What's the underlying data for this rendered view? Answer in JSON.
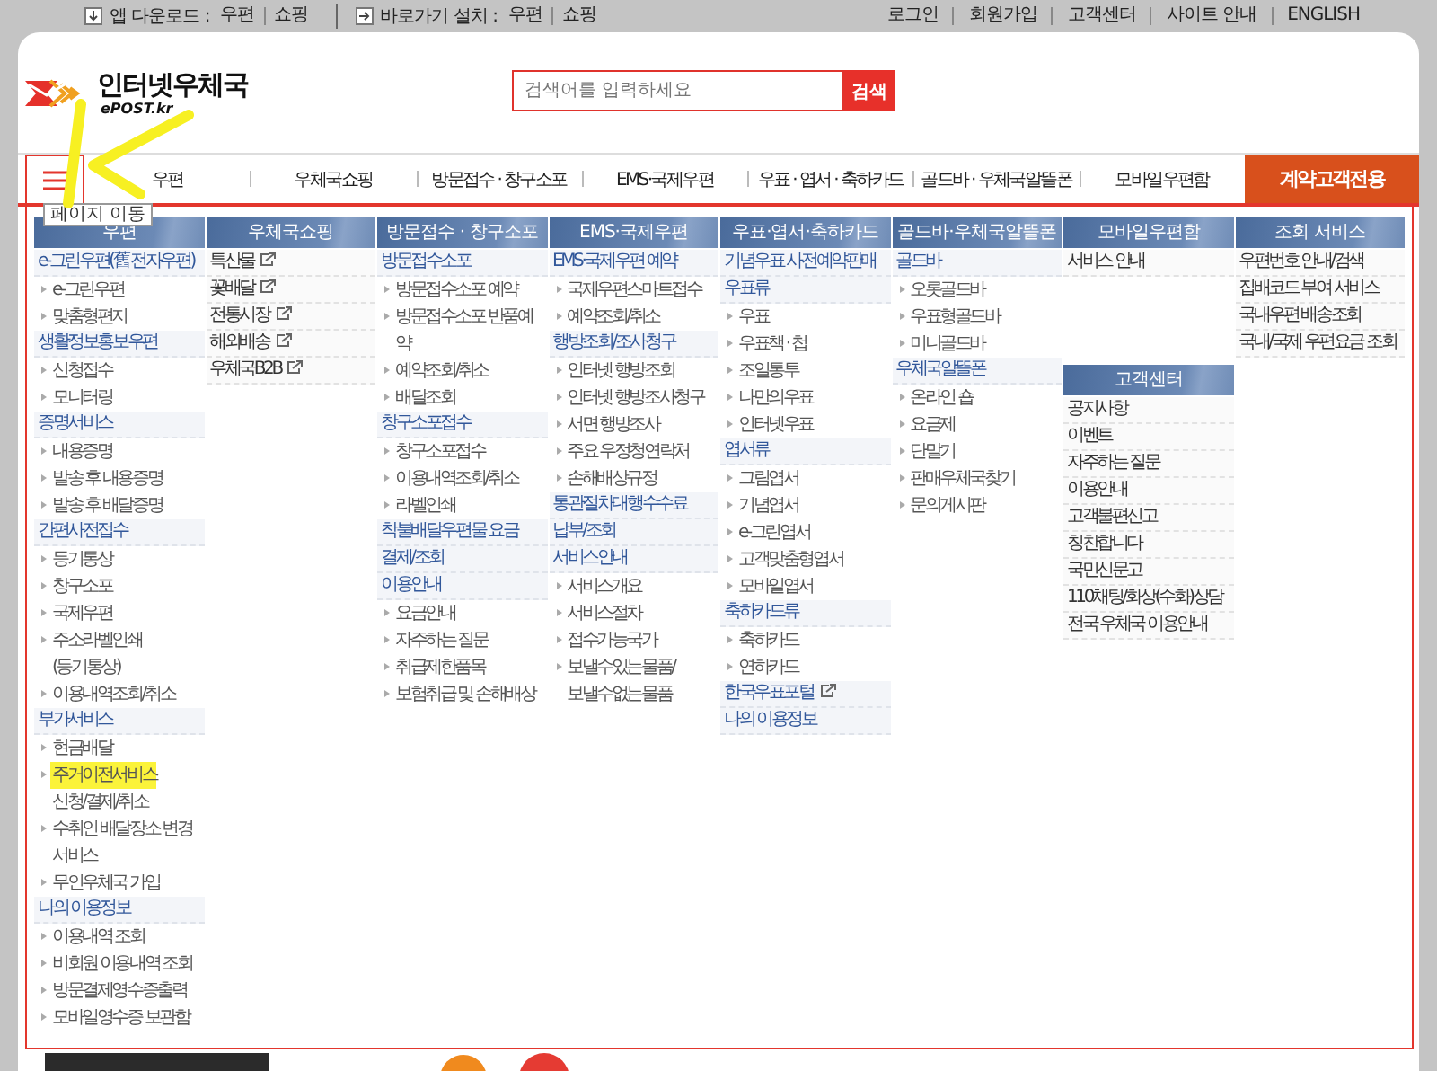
{
  "top_bar": {
    "groups": [
      {
        "kind": "download",
        "label": "앱 다운로드 :",
        "links": [
          "우편",
          "쇼핑"
        ]
      },
      {
        "kind": "shortcut",
        "label": "바로가기 설치 :",
        "links": [
          "우편",
          "쇼핑"
        ]
      }
    ],
    "user_links": [
      "로그인",
      "회원가입",
      "고객센터",
      "사이트 안내",
      "ENGLISH"
    ]
  },
  "header": {
    "logo": {
      "title": "인터넷우체국",
      "subtitle": "ePOST.kr"
    },
    "search": {
      "placeholder": "검색어를 입력하세요",
      "button": "검색"
    }
  },
  "nav": {
    "tooltip": "페이지 이동",
    "items": [
      {
        "label": "우편",
        "kind": "normal"
      },
      {
        "label": "우체국쇼핑",
        "kind": "normal"
      },
      {
        "label": "방문접수 · 창구소포",
        "kind": "normal"
      },
      {
        "label": "EMS·국제우편",
        "kind": "normal"
      },
      {
        "label": "우표 · 엽서 · 축하카드",
        "kind": "normal"
      },
      {
        "label": "골드바 · 우체국알뜰폰",
        "kind": "normal"
      },
      {
        "label": "모바일우편함",
        "kind": "normal"
      },
      {
        "label": "계약고객전용",
        "kind": "special"
      }
    ]
  },
  "mega_menu": {
    "columns": [
      {
        "panels": [
          {
            "title": "우편",
            "items": [
              {
                "text": "e-그린우편(舊 전자우편)",
                "kind": "section",
                "highlighted": false
              },
              {
                "text": "e-그린우편",
                "kind": "sub",
                "highlighted": false
              },
              {
                "text": "맞춤형편지",
                "kind": "sub",
                "highlighted": false
              },
              {
                "text": "생활정보홍보우편",
                "kind": "section",
                "highlighted": false
              },
              {
                "text": "신청접수",
                "kind": "sub",
                "highlighted": false
              },
              {
                "text": "모니터링",
                "kind": "sub",
                "highlighted": false
              },
              {
                "text": "증명서비스",
                "kind": "section",
                "highlighted": false
              },
              {
                "text": "내용증명",
                "kind": "sub",
                "highlighted": false
              },
              {
                "text": "발송 후 내용증명",
                "kind": "sub",
                "highlighted": false
              },
              {
                "text": "발송 후 배달증명",
                "kind": "sub",
                "highlighted": false
              },
              {
                "text": "간편사전접수",
                "kind": "section",
                "highlighted": false
              },
              {
                "text": "등기통상",
                "kind": "sub",
                "highlighted": false
              },
              {
                "text": "창구소포",
                "kind": "sub",
                "highlighted": false
              },
              {
                "text": "국제우편",
                "kind": "sub",
                "highlighted": false
              },
              {
                "text": "주소라벨인쇄",
                "kind": "sub",
                "highlighted": false
              },
              {
                "text": "(등기통상)",
                "kind": "cont",
                "highlighted": false
              },
              {
                "text": "이용내역조회/취소",
                "kind": "sub",
                "highlighted": false
              },
              {
                "text": "부가서비스",
                "kind": "section",
                "highlighted": false
              },
              {
                "text": "현금배달",
                "kind": "sub",
                "highlighted": false
              },
              {
                "text": "주거이전서비스",
                "kind": "sub",
                "highlighted": true
              },
              {
                "text": "신청/결제/취소",
                "kind": "cont",
                "highlighted": false
              },
              {
                "text": "수취인 배달장소 변경",
                "kind": "sub",
                "highlighted": false
              },
              {
                "text": "서비스",
                "kind": "cont",
                "highlighted": false
              },
              {
                "text": "무인우체국 가입",
                "kind": "sub",
                "highlighted": false
              },
              {
                "text": "나의 이용정보",
                "kind": "section",
                "highlighted": false
              },
              {
                "text": "이용내역 조회",
                "kind": "sub",
                "highlighted": false
              },
              {
                "text": "비회원 이용내역 조회",
                "kind": "sub",
                "highlighted": false
              },
              {
                "text": "방문결제영수증출력",
                "kind": "sub",
                "highlighted": false
              },
              {
                "text": "모바일영수증 보관함",
                "kind": "sub",
                "highlighted": false
              }
            ]
          }
        ]
      },
      {
        "panels": [
          {
            "title": "우체국쇼핑",
            "items": [
              {
                "text": "특산물",
                "kind": "plain",
                "external": true
              },
              {
                "text": "꽃배달",
                "kind": "plain",
                "external": true
              },
              {
                "text": "전통시장",
                "kind": "plain",
                "external": true
              },
              {
                "text": "해외배송",
                "kind": "plain",
                "external": true
              },
              {
                "text": "우체국B2B",
                "kind": "plain",
                "external": true
              }
            ]
          }
        ]
      },
      {
        "panels": [
          {
            "title": "방문접수 · 창구소포",
            "items": [
              {
                "text": "방문접수소포",
                "kind": "section"
              },
              {
                "text": "방문접수소포 예약",
                "kind": "sub"
              },
              {
                "text": "방문접수소포 반품예",
                "kind": "sub"
              },
              {
                "text": "약",
                "kind": "cont"
              },
              {
                "text": "예약조회/취소",
                "kind": "sub"
              },
              {
                "text": "배달조회",
                "kind": "sub"
              },
              {
                "text": "창구소포접수",
                "kind": "section"
              },
              {
                "text": "창구소포접수",
                "kind": "sub"
              },
              {
                "text": "이용내역조회/취소",
                "kind": "sub"
              },
              {
                "text": "라벨인쇄",
                "kind": "sub"
              },
              {
                "text": "착불배달우편물 요금",
                "kind": "section"
              },
              {
                "text": "결제/조회",
                "kind": "section"
              },
              {
                "text": "이용안내",
                "kind": "section"
              },
              {
                "text": "요금안내",
                "kind": "sub"
              },
              {
                "text": "자주하는 질문",
                "kind": "sub"
              },
              {
                "text": "취급제한품목",
                "kind": "sub"
              },
              {
                "text": "보험취급 및 손해배상",
                "kind": "sub"
              }
            ]
          }
        ]
      },
      {
        "panels": [
          {
            "title": "EMS·국제우편",
            "items": [
              {
                "text": "EMS·국제우편 예약",
                "kind": "section"
              },
              {
                "text": "국제우편스마트접수",
                "kind": "sub"
              },
              {
                "text": "예약조회/취소",
                "kind": "sub"
              },
              {
                "text": "행방조회/조사청구",
                "kind": "section"
              },
              {
                "text": "인터넷 행방조회",
                "kind": "sub"
              },
              {
                "text": "인터넷 행방조사청구",
                "kind": "sub"
              },
              {
                "text": "서면 행방조사",
                "kind": "sub"
              },
              {
                "text": "주요 우정청연락처",
                "kind": "sub"
              },
              {
                "text": "손해배상규정",
                "kind": "sub"
              },
              {
                "text": "통관절차대행수수료",
                "kind": "section"
              },
              {
                "text": "납부/조회",
                "kind": "section"
              },
              {
                "text": "서비스안내",
                "kind": "section"
              },
              {
                "text": "서비스개요",
                "kind": "sub"
              },
              {
                "text": "서비스절차",
                "kind": "sub"
              },
              {
                "text": "접수가능국가",
                "kind": "sub"
              },
              {
                "text": "보낼수있는물품/",
                "kind": "sub"
              },
              {
                "text": "보낼수없는물품",
                "kind": "cont"
              }
            ]
          }
        ]
      },
      {
        "panels": [
          {
            "title": "우표·엽서·축하카드",
            "items": [
              {
                "text": "기념우표 사전예약판매",
                "kind": "section",
                "external": false
              },
              {
                "text": "우표류",
                "kind": "section",
                "external": false
              },
              {
                "text": "우표",
                "kind": "sub",
                "external": false
              },
              {
                "text": "우표책 · 첩",
                "kind": "sub",
                "external": false
              },
              {
                "text": "조일통투",
                "kind": "sub",
                "external": false
              },
              {
                "text": "나만의우표",
                "kind": "sub",
                "external": false
              },
              {
                "text": "인터넷우표",
                "kind": "sub",
                "external": false
              },
              {
                "text": "엽서류",
                "kind": "section",
                "external": false
              },
              {
                "text": "그림엽서",
                "kind": "sub",
                "external": false
              },
              {
                "text": "기념엽서",
                "kind": "sub",
                "external": false
              },
              {
                "text": "e-그린엽서",
                "kind": "sub",
                "external": false
              },
              {
                "text": "고객맞춤형엽서",
                "kind": "sub",
                "external": false
              },
              {
                "text": "모바일엽서",
                "kind": "sub",
                "external": false
              },
              {
                "text": "축하카드류",
                "kind": "section",
                "external": false
              },
              {
                "text": "축하카드",
                "kind": "sub",
                "external": false
              },
              {
                "text": "연하카드",
                "kind": "sub",
                "external": false
              },
              {
                "text": "한국우표포털",
                "kind": "section",
                "external": true
              },
              {
                "text": "나의 이용정보",
                "kind": "section",
                "external": false
              }
            ]
          }
        ]
      },
      {
        "panels": [
          {
            "title": "골드바·우체국알뜰폰",
            "items": [
              {
                "text": "골드바",
                "kind": "section"
              },
              {
                "text": "오롯골드바",
                "kind": "sub"
              },
              {
                "text": "우표형골드바",
                "kind": "sub"
              },
              {
                "text": "미니골드바",
                "kind": "sub"
              },
              {
                "text": "우체국알뜰폰",
                "kind": "section"
              },
              {
                "text": "온라인 숍",
                "kind": "sub"
              },
              {
                "text": "요금제",
                "kind": "sub"
              },
              {
                "text": "단말기",
                "kind": "sub"
              },
              {
                "text": "판매우체국찾기",
                "kind": "sub"
              },
              {
                "text": "문의게시판",
                "kind": "sub"
              }
            ]
          }
        ]
      },
      {
        "panels": [
          {
            "title": "모바일우편함",
            "items": [
              {
                "text": "서비스 안내",
                "kind": "plain"
              }
            ]
          },
          {
            "title": "고객센터",
            "items": [
              {
                "text": "공지사항",
                "kind": "plain"
              },
              {
                "text": "이벤트",
                "kind": "plain"
              },
              {
                "text": "자주하는 질문",
                "kind": "plain"
              },
              {
                "text": "이용안내",
                "kind": "plain"
              },
              {
                "text": "고객불편신고",
                "kind": "plain"
              },
              {
                "text": "칭찬합니다",
                "kind": "plain"
              },
              {
                "text": "국민신문고",
                "kind": "plain"
              },
              {
                "text": "110채팅/화상(수화)상담",
                "kind": "plain"
              },
              {
                "text": "전국 우체국 이용안내",
                "kind": "plain"
              }
            ]
          }
        ]
      },
      {
        "panels": [
          {
            "title": "조회 서비스",
            "items": [
              {
                "text": "우편번호 안내/검색",
                "kind": "plain"
              },
              {
                "text": "집배코드 부여 서비스",
                "kind": "plain"
              },
              {
                "text": "국내우편 배송조회",
                "kind": "plain"
              },
              {
                "text": "국내/국제 우편요금 조회",
                "kind": "plain"
              }
            ]
          }
        ]
      }
    ]
  }
}
